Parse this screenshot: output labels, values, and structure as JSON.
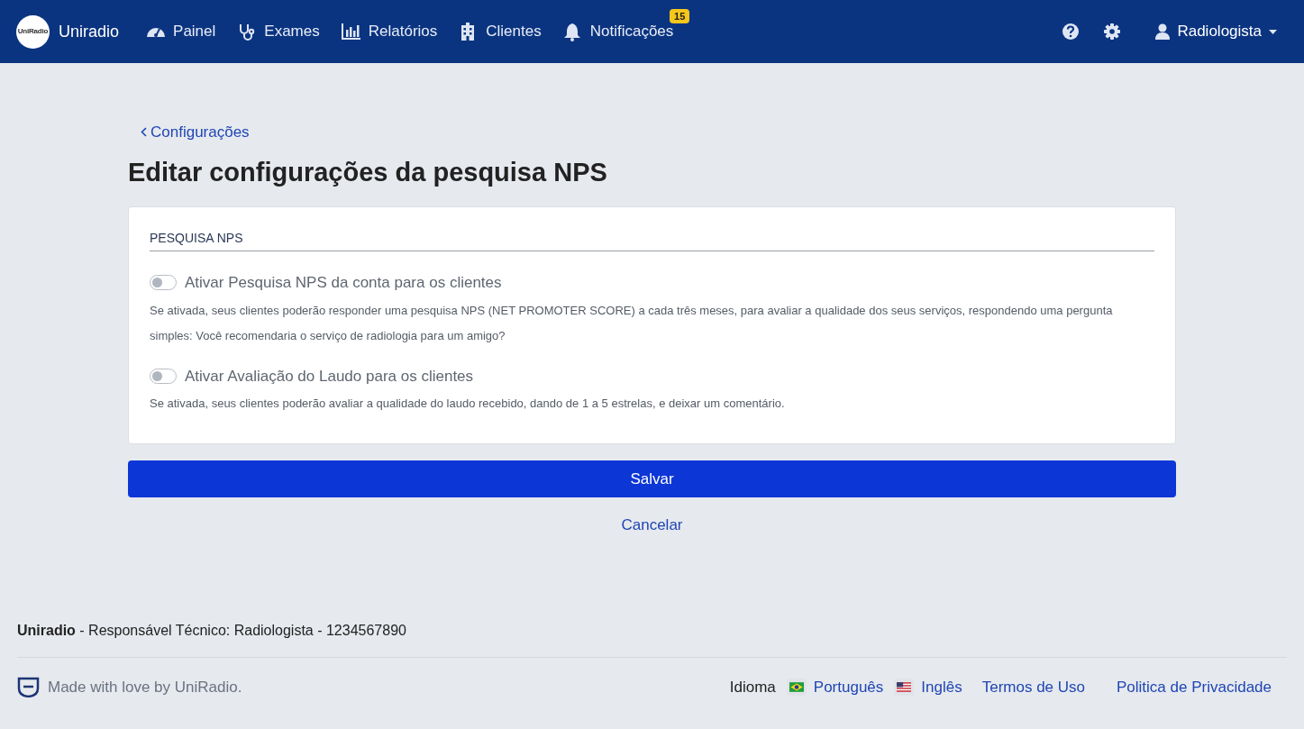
{
  "navbar": {
    "logo_text": "UniRadio",
    "brand": "Uniradio",
    "items": [
      {
        "kind": "gauge",
        "label": "Painel"
      },
      {
        "kind": "stethoscope",
        "label": "Exames"
      },
      {
        "kind": "chart",
        "label": "Relatórios"
      },
      {
        "kind": "building",
        "label": "Clientes"
      },
      {
        "kind": "bell",
        "label": "Notificações",
        "badge": "15"
      }
    ],
    "user": "Radiologista"
  },
  "back_link": "Configurações",
  "title": "Editar configurações da pesquisa NPS",
  "section": "PESQUISA NPS",
  "toggles": [
    {
      "label": "Ativar Pesquisa NPS da conta para os clientes",
      "on": false,
      "help": "Se ativada, seus clientes poderão responder uma pesquisa NPS (NET PROMOTER SCORE) a cada três meses, para avaliar a qualidade dos seus serviços, respondendo uma pergunta simples: Você recomendaria o serviço de radiologia para um amigo?"
    },
    {
      "label": "Ativar Avaliação do Laudo para os clientes",
      "on": false,
      "help": "Se ativada, seus clientes poderão avaliar a qualidade do laudo recebido, dando de 1 a 5 estrelas, e deixar um comentário."
    }
  ],
  "save_button": "Salvar",
  "cancel_link": "Cancelar",
  "footer": {
    "responsible": "**Uniradio** - Responsável Técnico: Radiologista - 1234567890",
    "made_with": "Made with love by UniRadio.",
    "language_label": "Idioma",
    "languages": [
      {
        "kind": "br",
        "label": "Português"
      },
      {
        "kind": "us",
        "label": "Inglês"
      }
    ],
    "links": [
      "Termos de Uso",
      "Politica de Privacidade"
    ]
  }
}
